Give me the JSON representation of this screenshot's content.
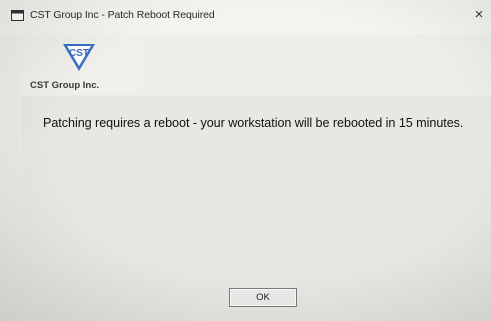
{
  "window": {
    "title": "CST Group Inc - Patch Reboot Required",
    "close_symbol": "×",
    "title_icon": "window-app-icon"
  },
  "logo": {
    "icon": "cst-logo-icon",
    "company_name": "CST Group Inc.",
    "brand_color": "#3a6fc4"
  },
  "body": {
    "message": "Patching requires a reboot - your workstation will be rebooted in 15 minutes."
  },
  "actions": {
    "ok_label": "OK"
  }
}
